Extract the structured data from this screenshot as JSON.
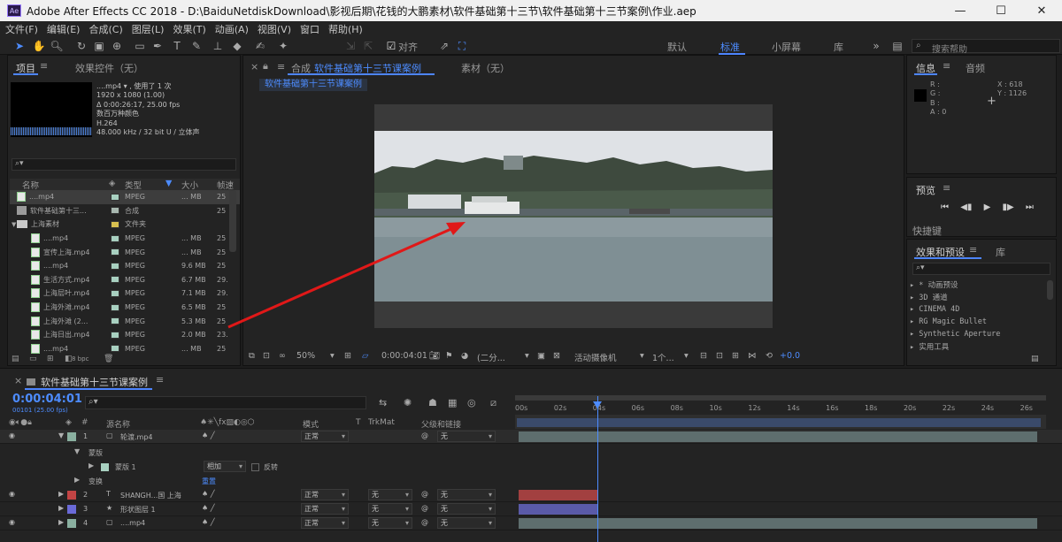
{
  "window": {
    "title": "Adobe After Effects CC 2018 - D:\\BaiduNetdiskDownload\\影视后期\\花钱的大鹏素材\\软件基础第十三节\\软件基础第十三节案例\\作业.aep",
    "app_icon": "Ae"
  },
  "menu": [
    "文件(F)",
    "编辑(E)",
    "合成(C)",
    "图层(L)",
    "效果(T)",
    "动画(A)",
    "视图(V)",
    "窗口",
    "帮助(H)"
  ],
  "toolbar": {
    "align_label": "对齐",
    "workspaces": [
      "默认",
      "标准",
      "小屏幕",
      "库"
    ],
    "search_placeholder": "搜索帮助"
  },
  "project": {
    "tab_project": "项目",
    "tab_effects": "效果控件（无）",
    "info": {
      "name": "....mp4 ▾ , 使用了 1 次",
      "size": "1920 x 1080 (1.00)",
      "duration": "Δ 0:00:26:17, 25.00 fps",
      "colors": "数百万种颜色",
      "codec": "H.264",
      "audio": "48.000 kHz / 32 bit U / 立体声"
    },
    "columns": [
      "名称",
      "类型",
      "大小",
      "帧速"
    ],
    "items": [
      {
        "name": "....mp4",
        "type": "MPEG",
        "size": "... MB",
        "fps": "25",
        "kind": "file",
        "indent": 0,
        "selected": true
      },
      {
        "name": "软件基础第十三...",
        "type": "合成",
        "size": "",
        "fps": "25",
        "kind": "comp",
        "indent": 0
      },
      {
        "name": "上海素材",
        "type": "文件夹",
        "size": "",
        "fps": "",
        "kind": "folder",
        "indent": 0,
        "expander": "▼"
      },
      {
        "name": "....mp4",
        "type": "MPEG",
        "size": "... MB",
        "fps": "25",
        "kind": "file",
        "indent": 1
      },
      {
        "name": "宣传上海.mp4",
        "type": "MPEG",
        "size": "... MB",
        "fps": "25",
        "kind": "file",
        "indent": 1
      },
      {
        "name": "....mp4",
        "type": "MPEG",
        "size": "9.6 MB",
        "fps": "25",
        "kind": "file",
        "indent": 1
      },
      {
        "name": "生活方式.mp4",
        "type": "MPEG",
        "size": "6.7 MB",
        "fps": "29.",
        "kind": "file",
        "indent": 1
      },
      {
        "name": "上海层叶.mp4",
        "type": "MPEG",
        "size": "7.1 MB",
        "fps": "29.",
        "kind": "file",
        "indent": 1
      },
      {
        "name": "上海外滩.mp4",
        "type": "MPEG",
        "size": "6.5 MB",
        "fps": "25",
        "kind": "file",
        "indent": 1
      },
      {
        "name": "上海外滩 (2...",
        "type": "MPEG",
        "size": "5.3 MB",
        "fps": "25",
        "kind": "file",
        "indent": 1
      },
      {
        "name": "上海日出.mp4",
        "type": "MPEG",
        "size": "2.0 MB",
        "fps": "23.",
        "kind": "file",
        "indent": 1
      },
      {
        "name": "....mp4",
        "type": "MPEG",
        "size": "... MB",
        "fps": "25",
        "kind": "file",
        "indent": 1
      }
    ],
    "bpc": "8 bpc"
  },
  "viewer": {
    "comp_tab_prefix": "合成",
    "comp_name": "软件基础第十三节课案例",
    "footage_tab": "素材（无）",
    "breadcrumb": "软件基础第十三节课案例",
    "zoom": "50%",
    "timecode": "0:00:04:01",
    "resolution": "(二分...",
    "camera": "活动摄像机",
    "views": "1个...",
    "exposure": "+0.0"
  },
  "info_panel": {
    "tab_info": "信息",
    "tab_audio": "音频",
    "r": "R :",
    "g": "G :",
    "b": "B :",
    "a": "A :  0",
    "x": "X : 618",
    "y": "Y : 1126"
  },
  "preview": {
    "title": "预览",
    "shortcut_label": "快捷键"
  },
  "effects": {
    "tab": "效果和预设",
    "tab_lib": "库",
    "items": [
      "* 动画预设",
      "3D 通道",
      "CINEMA 4D",
      "RG Magic Bullet",
      "Synthetic Aperture",
      "实用工具"
    ]
  },
  "timeline": {
    "comp_name": "软件基础第十三节课案例",
    "timecode": "0:00:04:01",
    "frame_info": "00101 (25.00 fps)",
    "columns": {
      "name": "源名称",
      "mode": "模式",
      "t": "T",
      "trkmat": "TrkMat",
      "parent": "父级和链接"
    },
    "ruler": [
      "00s",
      "02s",
      "04s",
      "06s",
      "08s",
      "10s",
      "12s",
      "14s",
      "16s",
      "18s",
      "20s",
      "22s",
      "24s",
      "26s"
    ],
    "playhead_seconds": 4.04,
    "duration_seconds": 26.7,
    "layers": [
      {
        "num": "1",
        "name": "轮渡.mp4",
        "mode": "正常",
        "trkmat": "",
        "parent": "无",
        "color": "#8ab0a0",
        "bar_color": "#5e6e6e",
        "bar_start": 0,
        "bar_end": 26.7
      },
      {
        "num": "2",
        "name": "SHANGH...国 上海",
        "mode": "正常",
        "trkmat": "无",
        "parent": "无",
        "color": "#c24444",
        "bar_color": "#a24040",
        "bar_start": 0,
        "bar_end": 4.04
      },
      {
        "num": "3",
        "name": "形状图层 1",
        "mode": "正常",
        "trkmat": "无",
        "parent": "无",
        "color": "#6a6ad8",
        "bar_color": "#5a5aa8",
        "bar_start": 0,
        "bar_end": 4.04
      },
      {
        "num": "4",
        "name": "....mp4",
        "mode": "正常",
        "trkmat": "无",
        "parent": "无",
        "color": "#8ab0a0",
        "bar_color": "#5e6e6e",
        "bar_start": 0,
        "bar_end": 26.7
      }
    ],
    "mask_group": "蒙版",
    "mask_name": "蒙版 1",
    "mask_mode": "相加",
    "mask_invert": "反转",
    "transform": "变换",
    "transform_reset": "重置"
  }
}
